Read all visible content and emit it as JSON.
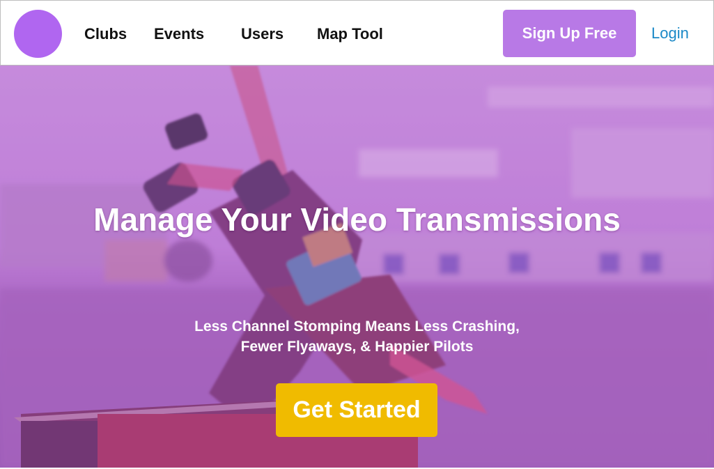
{
  "nav": {
    "logo_icon": "circle-logo",
    "links": [
      "Clubs",
      "Events",
      "Users",
      "Map Tool"
    ],
    "signup_label": "Sign Up Free",
    "login_label": "Login"
  },
  "hero": {
    "title": "Manage Your Video Transmissions",
    "subtitle_line1": "Less Channel Stomping Means Less Crashing,",
    "subtitle_line2": "Fewer Flyaways, & Happier Pilots",
    "cta_label": "Get Started",
    "background_image": "fpv-racing-drone-photo"
  },
  "colors": {
    "logo": "#b066f0",
    "signup_bg": "#b879e6",
    "login_text": "#1b89c7",
    "hero_overlay": "#b45fd6",
    "cta_bg": "#f0bb00"
  }
}
